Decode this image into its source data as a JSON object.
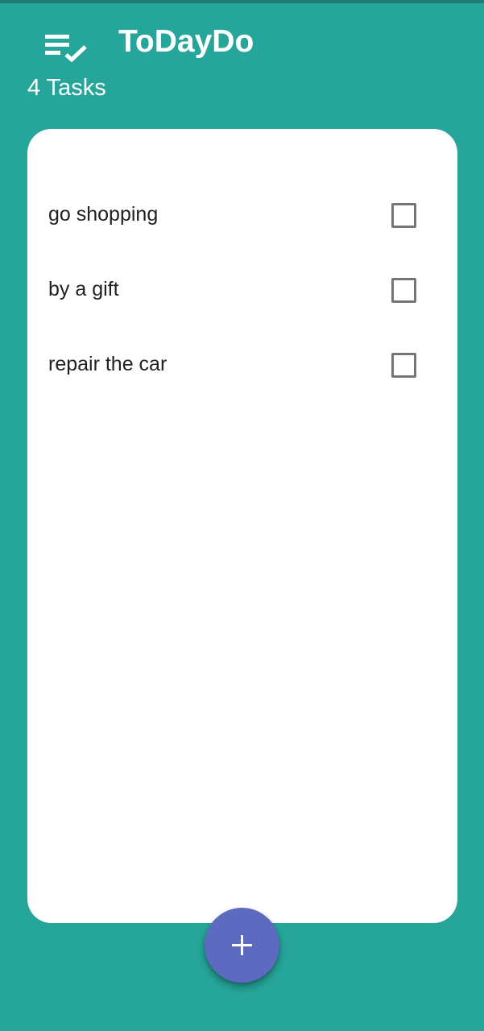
{
  "header": {
    "icon": "playlist-check-icon",
    "title": "ToDayDo",
    "task_count": "4 Tasks"
  },
  "tasks": [
    {
      "label": "go shopping",
      "checked": false
    },
    {
      "label": "by a gift",
      "checked": false
    },
    {
      "label": "repair the car",
      "checked": false
    }
  ],
  "fab": {
    "icon": "plus-icon"
  },
  "colors": {
    "background": "#26a69a",
    "card": "#ffffff",
    "fab": "#5c6bc0",
    "text": "#212121",
    "checkbox_border": "#757575"
  }
}
